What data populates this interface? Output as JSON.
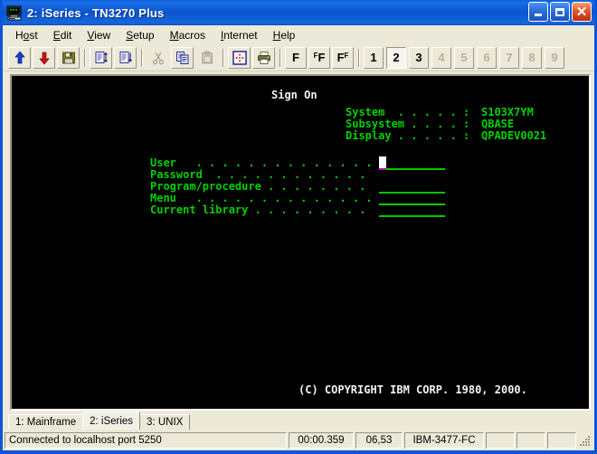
{
  "window": {
    "title": "2: iSeries - TN3270 Plus",
    "icon": "terminal-monitor-icon",
    "buttons": {
      "minimize": "minimize-icon",
      "maximize": "maximize-icon",
      "close": "close-icon"
    }
  },
  "menubar": {
    "items": [
      {
        "label": "Host",
        "pre": "H",
        "accel": "o",
        "post": "st"
      },
      {
        "label": "Edit",
        "pre": "",
        "accel": "E",
        "post": "dit"
      },
      {
        "label": "View",
        "pre": "",
        "accel": "V",
        "post": "iew"
      },
      {
        "label": "Setup",
        "pre": "",
        "accel": "S",
        "post": "etup"
      },
      {
        "label": "Macros",
        "pre": "",
        "accel": "M",
        "post": "acros"
      },
      {
        "label": "Internet",
        "pre": "",
        "accel": "I",
        "post": "nternet"
      },
      {
        "label": "Help",
        "pre": "",
        "accel": "H",
        "post": "elp"
      }
    ]
  },
  "toolbar": {
    "buttons": [
      {
        "name": "send-up-icon",
        "enabled": true
      },
      {
        "name": "receive-down-icon",
        "enabled": true
      },
      {
        "name": "save-icon",
        "enabled": true
      },
      {
        "name": "separator",
        "enabled": true
      },
      {
        "name": "copy-append-icon",
        "enabled": true
      },
      {
        "name": "copy-down-icon",
        "enabled": true
      },
      {
        "name": "separator",
        "enabled": true
      },
      {
        "name": "cut-icon",
        "enabled": false
      },
      {
        "name": "copy-icon",
        "enabled": true
      },
      {
        "name": "paste-icon",
        "enabled": false
      },
      {
        "name": "separator",
        "enabled": true
      },
      {
        "name": "resize-screen-icon",
        "enabled": true
      },
      {
        "name": "print-icon",
        "enabled": true
      }
    ],
    "fkeys": [
      {
        "label": "F",
        "sup_before": "",
        "sup_after": ""
      },
      {
        "label": "F",
        "sup_before": "F",
        "sup_after": ""
      },
      {
        "label": "F",
        "sup_before": "",
        "sup_after": "F"
      }
    ],
    "sessions": [
      {
        "label": "1",
        "active": false,
        "enabled": true
      },
      {
        "label": "2",
        "active": true,
        "enabled": true
      },
      {
        "label": "3",
        "active": false,
        "enabled": true
      },
      {
        "label": "4",
        "active": false,
        "enabled": false
      },
      {
        "label": "5",
        "active": false,
        "enabled": false
      },
      {
        "label": "6",
        "active": false,
        "enabled": false
      },
      {
        "label": "7",
        "active": false,
        "enabled": false
      },
      {
        "label": "8",
        "active": false,
        "enabled": false
      },
      {
        "label": "9",
        "active": false,
        "enabled": false
      }
    ]
  },
  "terminal": {
    "heading": "Sign On",
    "info": [
      {
        "label": "System  . . . . . :",
        "value": "S103X7YM"
      },
      {
        "label": "Subsystem . . . . :",
        "value": "QBASE"
      },
      {
        "label": "Display . . . . . :",
        "value": "QPADEV0021"
      }
    ],
    "fields": [
      {
        "label": "User   . . . . . . . . . . . . . .",
        "value": "",
        "underline": true,
        "cursor": true
      },
      {
        "label": "Password  . . . . . . . . . . . .",
        "value": "",
        "underline": false,
        "cursor": false
      },
      {
        "label": "Program/procedure . . . . . . . .",
        "value": "",
        "underline": true,
        "cursor": false
      },
      {
        "label": "Menu   . . . . . . . . . . . . . .",
        "value": "",
        "underline": true,
        "cursor": false
      },
      {
        "label": "Current library . . . . . . . . .",
        "value": "",
        "underline": true,
        "cursor": false
      }
    ],
    "copyright": "(C) COPYRIGHT IBM CORP. 1980, 2000.",
    "colors": {
      "background": "#000000",
      "green": "#00d000",
      "white": "#f2f2f2",
      "cursor": "#ffffff",
      "cursor_underline": "#c000c0"
    }
  },
  "tabs": [
    {
      "label": "1: Mainframe",
      "active": false
    },
    {
      "label": "2: iSeries",
      "active": true
    },
    {
      "label": "3: UNIX",
      "active": false
    }
  ],
  "statusbar": {
    "message": "Connected to localhost port 5250",
    "cells": [
      {
        "name": "elapsed-time",
        "value": "00:00.359"
      },
      {
        "name": "cursor-position",
        "value": "06,53"
      },
      {
        "name": "terminal-type",
        "value": "IBM-3477-FC"
      },
      {
        "name": "status-cell-4",
        "value": ""
      },
      {
        "name": "status-cell-5",
        "value": ""
      },
      {
        "name": "status-cell-6",
        "value": ""
      }
    ]
  }
}
